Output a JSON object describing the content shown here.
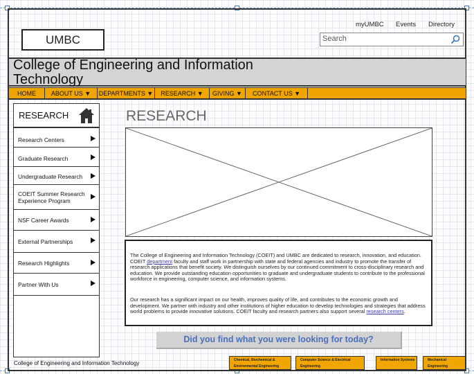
{
  "header": {
    "logo": "UMBC",
    "top_links": [
      "myUMBC",
      "Events",
      "Directory"
    ],
    "search_placeholder": "Search"
  },
  "banner": {
    "title": "College of Engineering and Information Technology"
  },
  "nav": [
    "HOME",
    "ABOUT US ▼",
    "DEPARTMENTS ▼",
    "RESEARCH ▼",
    "GIVING ▼",
    "CONTACT US ▼"
  ],
  "sidebar": {
    "title": "RESEARCH",
    "items": [
      "Research Centers",
      "Graduate Research",
      "Undergraduate Research",
      "COEIT Summer Research Experience Program",
      "NSF Career Awards",
      "External Partnerships",
      "Research Highlights",
      "Partner With Us"
    ]
  },
  "main": {
    "title": "RESEARCH",
    "para1_a": "The College of Engineering and Information Technology (COEIT) and UMBC are dedicated to research, innovation, and education. COEIT ",
    "para1_link": "department",
    "para1_b": " faculty and staff work in partnership with state and federal agencies and industry to promote the transfer of research applications that benefit society. We distinguish ourselves by our continued commitment to cross-disciplinary research and education. We provide outstanding education opportunities to graduate and undergraduate students to contribute to the professional workforce in engineering, computer science, and information systems.",
    "para2_a": "Our research has a significant impact on our health, improves quality of life, and contributes to the economic growth and development. We partner with industry and other institutions of higher education to develop technologies and strategies that address world problems to provide innovative solutions. COEIT faculty and research partners also support several ",
    "para2_link": "research centers",
    "para2_b": "."
  },
  "feedback": "Did you find what you were looking for today?",
  "footer": {
    "text": "College of Engineering and Information Technology",
    "links": [
      "Chemical, Biochemical & Environmental Engineering",
      "Computer Science & Electrical Engineering",
      "Information Systems",
      "Mechanical Engineering"
    ]
  }
}
